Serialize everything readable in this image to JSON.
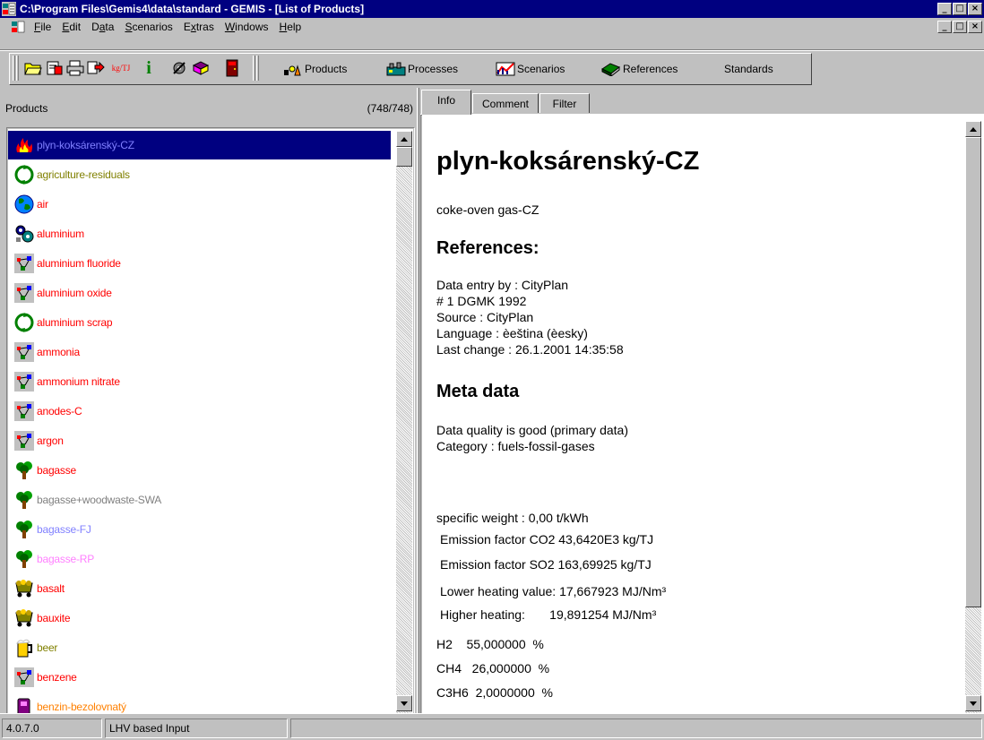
{
  "window": {
    "title": "C:\\Program Files\\Gemis4\\data\\standard - GEMIS - [List of Products]",
    "caption_buttons": [
      "_",
      "□",
      "×"
    ],
    "mdi_buttons": [
      "_",
      "□",
      "×"
    ]
  },
  "menu": [
    {
      "pre": "",
      "u": "F",
      "post": "ile"
    },
    {
      "pre": "",
      "u": "E",
      "post": "dit"
    },
    {
      "pre": "D",
      "u": "a",
      "post": "ta"
    },
    {
      "pre": "",
      "u": "S",
      "post": "cenarios"
    },
    {
      "pre": "E",
      "u": "x",
      "post": "tras"
    },
    {
      "pre": "",
      "u": "W",
      "post": "indows"
    },
    {
      "pre": "",
      "u": "H",
      "post": "elp"
    }
  ],
  "toolbar": {
    "icons": [
      "open-folder-icon",
      "save-icon",
      "print-icon",
      "export-icon",
      "unit-converter-icon",
      "info-icon",
      "settings-icon",
      "book-icon",
      "exit-door-icon"
    ],
    "info_glyph": "i",
    "unit_glyph": "kg/TJ",
    "nav": [
      {
        "label": "Products",
        "icon": "products-icon"
      },
      {
        "label": "Processes",
        "icon": "processes-icon"
      },
      {
        "label": "Scenarios",
        "icon": "scenarios-icon"
      },
      {
        "label": "References",
        "icon": "references-icon"
      },
      {
        "label": "Standards",
        "icon": ""
      }
    ]
  },
  "left_panel": {
    "title": "Products",
    "count": "(748/748)",
    "items": [
      {
        "label": "plyn-koksárenský-CZ",
        "color": "#8080ff",
        "icon": "flame-icon",
        "selected": true
      },
      {
        "label": "agriculture-residuals",
        "color": "#808000",
        "icon": "recycle-icon"
      },
      {
        "label": "air",
        "color": "#ff0000",
        "icon": "globe-icon"
      },
      {
        "label": "aluminium",
        "color": "#ff0000",
        "icon": "gears-icon"
      },
      {
        "label": "aluminium fluoride",
        "color": "#ff0000",
        "icon": "chemical-icon"
      },
      {
        "label": "aluminium oxide",
        "color": "#ff0000",
        "icon": "chemical-icon"
      },
      {
        "label": "aluminium scrap",
        "color": "#ff0000",
        "icon": "recycle-icon"
      },
      {
        "label": "ammonia",
        "color": "#ff0000",
        "icon": "chemical-icon"
      },
      {
        "label": "ammonium nitrate",
        "color": "#ff0000",
        "icon": "chemical-icon"
      },
      {
        "label": "anodes-C",
        "color": "#ff0000",
        "icon": "chemical-icon"
      },
      {
        "label": "argon",
        "color": "#ff0000",
        "icon": "chemical-icon"
      },
      {
        "label": "bagasse",
        "color": "#ff0000",
        "icon": "tree-icon"
      },
      {
        "label": "bagasse+woodwaste-SWA",
        "color": "#808080",
        "icon": "tree-icon"
      },
      {
        "label": "bagasse-FJ",
        "color": "#8080ff",
        "icon": "tree-icon"
      },
      {
        "label": "bagasse-RP",
        "color": "#ff80ff",
        "icon": "tree-icon"
      },
      {
        "label": "basalt",
        "color": "#ff0000",
        "icon": "minecart-icon"
      },
      {
        "label": "bauxite",
        "color": "#ff0000",
        "icon": "minecart-icon"
      },
      {
        "label": "beer",
        "color": "#808000",
        "icon": "beer-icon"
      },
      {
        "label": "benzene",
        "color": "#ff0000",
        "icon": "chemical-icon"
      },
      {
        "label": "benzin-bezolovnatý",
        "color": "#ff8000",
        "icon": "fuel-icon"
      }
    ]
  },
  "tabs": [
    {
      "label": "Info",
      "active": true
    },
    {
      "label": "Comment",
      "active": false
    },
    {
      "label": "Filter",
      "active": false
    }
  ],
  "detail": {
    "name": "plyn-koksárenský-CZ",
    "english": "coke-oven gas-CZ",
    "references_heading": "References:",
    "references": [
      "Data entry by : CityPlan",
      "# 1 DGMK 1992",
      "Source : CityPlan",
      "Language : èeština (èesky)",
      "Last change : 26.1.2001 14:35:58"
    ],
    "meta_heading": "Meta data",
    "meta": [
      "Data quality is good (primary data)",
      "Category : fuels-fossil-gases"
    ],
    "specific_weight": "specific weight : 0,00 t/kWh",
    "props": [
      "Emission factor CO2 43,6420E3 kg/TJ",
      "Emission factor SO2 163,69925 kg/TJ",
      "Lower heating value: 17,667923 MJ/Nm³",
      "Higher heating:       19,891254 MJ/Nm³",
      "H2    55,000000  %",
      "CH4   26,000000  %",
      "C3H6  2,0000000  %"
    ]
  },
  "status": {
    "version": "4.0.7.0",
    "mode": "LHV based Input",
    "extra": ""
  }
}
